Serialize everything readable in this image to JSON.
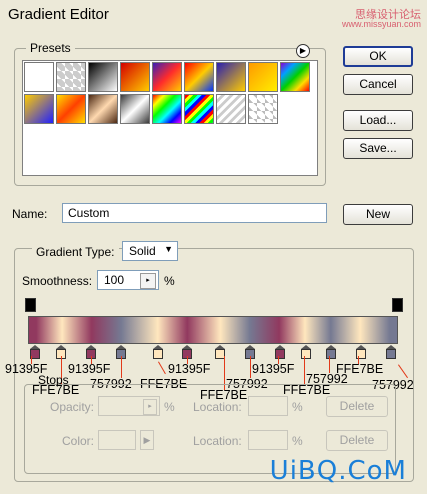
{
  "window": {
    "title": "Gradient Editor",
    "watermark": "思缘设计论坛",
    "watermark_sub": "www.missyuan.com"
  },
  "presets": {
    "label": "Presets",
    "menu_icon": "right-arrow-circle-icon"
  },
  "buttons": {
    "ok": "OK",
    "cancel": "Cancel",
    "load": "Load...",
    "save": "Save...",
    "new": "New"
  },
  "name": {
    "label": "Name:",
    "value": "Custom"
  },
  "gradient": {
    "type_label": "Gradient Type:",
    "type_value": "Solid",
    "smoothness_label": "Smoothness:",
    "smoothness_value": "100",
    "smoothness_unit": "%",
    "stops": [
      {
        "color": "#91395F",
        "pos": 0.02
      },
      {
        "color": "#FFE7BE",
        "pos": 0.09
      },
      {
        "color": "#91395F",
        "pos": 0.17
      },
      {
        "color": "#757992",
        "pos": 0.25
      },
      {
        "color": "#FFE7BE",
        "pos": 0.35
      },
      {
        "color": "#91395F",
        "pos": 0.43
      },
      {
        "color": "#FFE7BE",
        "pos": 0.52
      },
      {
        "color": "#757992",
        "pos": 0.6
      },
      {
        "color": "#91395F",
        "pos": 0.68
      },
      {
        "color": "#FFE7BE",
        "pos": 0.75
      },
      {
        "color": "#757992",
        "pos": 0.82
      },
      {
        "color": "#FFE7BE",
        "pos": 0.9
      },
      {
        "color": "#757992",
        "pos": 0.98
      }
    ]
  },
  "annotations": {
    "stop1": "91395F",
    "stop2": "FFE7BE",
    "stop3": "91395F",
    "stop4": "757992",
    "stop5": "FFE7BE",
    "stop6": "91395F",
    "stop7": "FFE7BE",
    "stop8": "757992",
    "stop9": "91395F",
    "stop10": "FFE7BE",
    "stop11": "757992",
    "stop12": "FFE7BE",
    "stop13": "757992"
  },
  "stops_panel": {
    "label": "Stops",
    "opacity_label": "Opacity:",
    "opacity_unit": "%",
    "location_label": "Location:",
    "location_unit": "%",
    "delete": "Delete",
    "color_label": "Color:",
    "location2_label": "Location:",
    "location2_unit": "%",
    "delete2": "Delete"
  },
  "logo": "UiBQ.CoM"
}
